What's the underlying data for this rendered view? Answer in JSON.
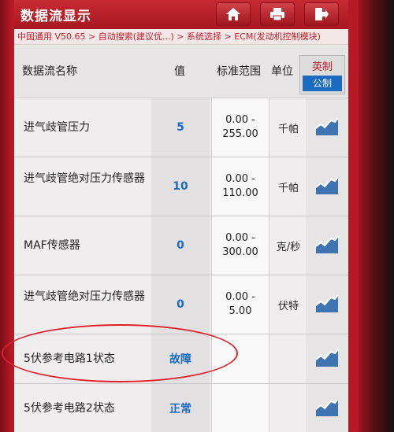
{
  "title": "数据流显示",
  "breadcrumb": "中国通用 V50.65 > 自动搜索(建议优...) > 系统选择 > ECM(发动机控制模块)",
  "toolbar": {
    "home_icon": "home-icon",
    "print_icon": "printer-icon",
    "exit_icon": "exit-icon"
  },
  "header": {
    "name": "数据流名称",
    "value": "值",
    "range": "标准范围",
    "unit": "单位"
  },
  "unit_toggle": {
    "imperial": "英制",
    "metric": "公制"
  },
  "rows": [
    {
      "name": "进气歧管压力",
      "value": "5",
      "range1": "0.00 -",
      "range2": "255.00",
      "unit": "千帕"
    },
    {
      "name": "进气歧管绝对压力传感器",
      "value": "10",
      "range1": "0.00 -",
      "range2": "110.00",
      "unit": "千帕"
    },
    {
      "name": "MAF传感器",
      "value": "0",
      "range1": "0.00 -",
      "range2": "300.00",
      "unit": "克/秒"
    },
    {
      "name": "进气歧管绝对压力传感器",
      "value": "0",
      "range1": "0.00 -",
      "range2": "5.00",
      "unit": "伏特"
    },
    {
      "name": "5伏参考电路1状态",
      "value": "故障",
      "range1": "",
      "range2": "",
      "unit": ""
    },
    {
      "name": "5伏参考电路2状态",
      "value": "正常",
      "range1": "",
      "range2": "",
      "unit": ""
    }
  ],
  "colors": {
    "accent": "#c0202a",
    "value_blue": "#1a6bc2",
    "highlight_oval": "#e0202a"
  }
}
